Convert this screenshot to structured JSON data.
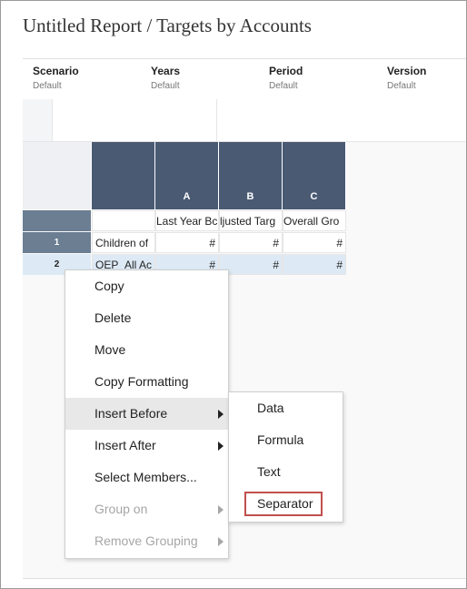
{
  "report": {
    "title": "Untitled Report / Targets by Accounts"
  },
  "pov": [
    {
      "label": "Scenario",
      "value": "Default"
    },
    {
      "label": "Years",
      "value": "Default"
    },
    {
      "label": "Period",
      "value": "Default"
    },
    {
      "label": "Version",
      "value": "Default"
    }
  ],
  "grid": {
    "columns": [
      {
        "letter": "A",
        "header": "Last Year Bc"
      },
      {
        "letter": "B",
        "header": "ljusted Targ"
      },
      {
        "letter": "C",
        "header": "Overall Gro"
      }
    ],
    "rows": [
      {
        "number": "1",
        "label": "Children of",
        "values": [
          "#",
          "#",
          "#"
        ]
      },
      {
        "number": "2",
        "label": "OEP_All Ac",
        "values": [
          "#",
          "#",
          "#"
        ]
      }
    ]
  },
  "context_menu": {
    "items": [
      {
        "label": "Copy"
      },
      {
        "label": "Delete"
      },
      {
        "label": "Move"
      },
      {
        "label": "Copy Formatting"
      },
      {
        "label": "Insert Before"
      },
      {
        "label": "Insert After"
      },
      {
        "label": "Select Members..."
      },
      {
        "label": "Group on"
      },
      {
        "label": "Remove Grouping"
      }
    ],
    "submenu": [
      {
        "label": "Data"
      },
      {
        "label": "Formula"
      },
      {
        "label": "Text"
      },
      {
        "label": "Separator"
      }
    ]
  },
  "colors": {
    "header_bg": "#4a5a73",
    "row_header_bg": "#6b7e92",
    "selected_row_bg": "#ddeaf5",
    "highlight_box": "#c0504d"
  }
}
